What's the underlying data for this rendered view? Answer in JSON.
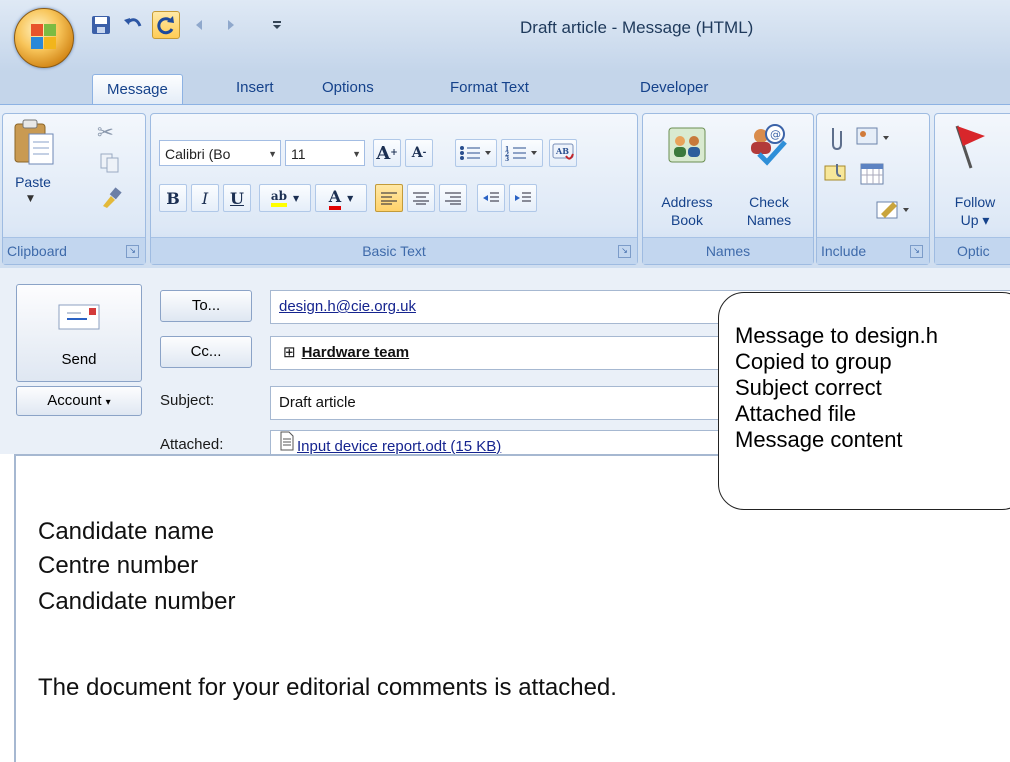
{
  "window": {
    "title": "Draft article - Message (HTML)"
  },
  "tabs": [
    "Message",
    "Insert",
    "Options",
    "Format Text",
    "Developer"
  ],
  "ribbon": {
    "clipboard": {
      "paste": "Paste",
      "label": "Clipboard"
    },
    "basic_text": {
      "font": "Calibri (Bo",
      "size": "11",
      "label": "Basic Text"
    },
    "names": {
      "address_book": [
        "Address",
        "Book"
      ],
      "check_names": [
        "Check",
        "Names"
      ],
      "label": "Names"
    },
    "include": {
      "label": "Include"
    },
    "follow_up": {
      "line1": "Follow",
      "line2": "Up",
      "label": "Optic"
    }
  },
  "compose": {
    "send": "Send",
    "to_button": "To...",
    "cc_button": "Cc...",
    "account": "Account",
    "subject_label": "Subject:",
    "attached_label": "Attached:",
    "to_value": "design.h@cie.org.uk",
    "cc_value": "Hardware team",
    "subject_value": "Draft article",
    "attachment": "Input device report.odt (15 KB)"
  },
  "body_lines": [
    "Candidate name",
    "Centre number",
    "Candidate number",
    "The document for your editorial comments is attached."
  ],
  "callout": [
    "Message to design.h",
    "Copied to group",
    "Subject correct",
    "Attached file",
    "Message content"
  ]
}
